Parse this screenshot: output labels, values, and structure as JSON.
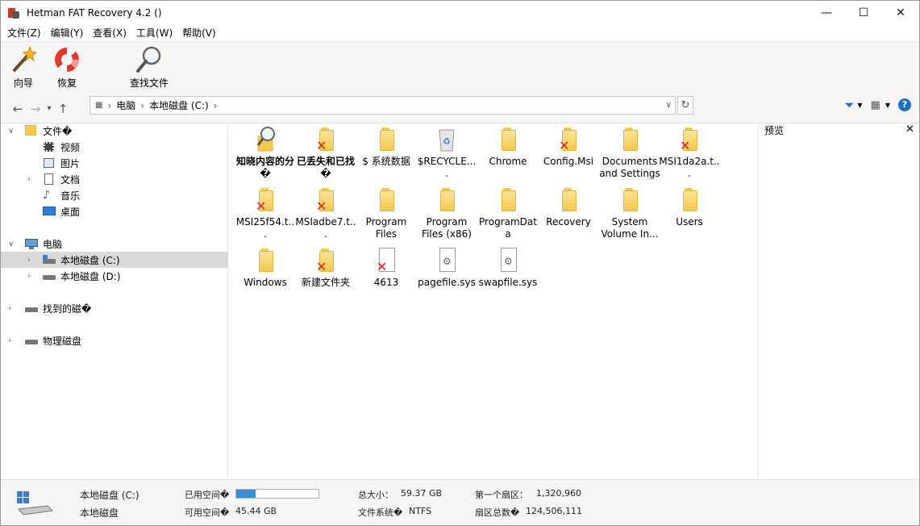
{
  "window": {
    "title": "Hetman FAT Recovery 4.2 ()",
    "minimize": "—",
    "maximize": "☐",
    "close": "✕"
  },
  "menu": [
    "文件(Z)",
    "编辑(Y)",
    "查看(X)",
    "工具(W)",
    "帮助(V)"
  ],
  "toolbar": {
    "wizard": "向导",
    "recover": "恢复",
    "find": "查找文件"
  },
  "address": {
    "root": "电脑",
    "drive": "本地磁盘 (C:)"
  },
  "tree": {
    "files": "文件�",
    "video": "视频",
    "pictures": "图片",
    "documents": "文档",
    "music": "音乐",
    "desktop": "桌面",
    "computer": "电脑",
    "drive_c": "本地磁盘 (C:)",
    "drive_d": "本地磁盘 (D:)",
    "found": "找到的磁�",
    "physical": "物理磁盘"
  },
  "files": [
    {
      "name": "知晓内容的分�",
      "type": "search",
      "bold": true
    },
    {
      "name": "已丢失和已找�",
      "type": "folder-x",
      "bold": true
    },
    {
      "name": "$ 系统数据",
      "type": "folder"
    },
    {
      "name": "$RECYCLE....",
      "type": "recycle"
    },
    {
      "name": "Chrome",
      "type": "folder"
    },
    {
      "name": "Config.Msi",
      "type": "folder-x"
    },
    {
      "name": "Documents and Settings",
      "type": "folder"
    },
    {
      "name": "MSI1da2a.t...",
      "type": "folder-x"
    },
    {
      "name": "MSI25f54.t...",
      "type": "folder-x"
    },
    {
      "name": "MSIadbe7.t...",
      "type": "folder-x"
    },
    {
      "name": "Program Files",
      "type": "folder"
    },
    {
      "name": "Program Files (x86)",
      "type": "folder"
    },
    {
      "name": "ProgramData",
      "type": "folder"
    },
    {
      "name": "Recovery",
      "type": "folder"
    },
    {
      "name": "System Volume In...",
      "type": "folder"
    },
    {
      "name": "Users",
      "type": "folder"
    },
    {
      "name": "Windows",
      "type": "folder"
    },
    {
      "name": "新建文件夹",
      "type": "folder-x"
    },
    {
      "name": "4613",
      "type": "doc-x"
    },
    {
      "name": "pagefile.sys",
      "type": "sys"
    },
    {
      "name": "swapfile.sys",
      "type": "sys"
    }
  ],
  "preview": {
    "title": "预览",
    "close": "✕"
  },
  "status": {
    "drive_name": "本地磁盘 (C:)",
    "drive_type": "本地磁盘",
    "used_label": "已用空间�",
    "used_fraction": 0.235,
    "free_label": "可用空间�",
    "free_value": "45.44 GB",
    "total_label": "总大小：",
    "total_value": "59.37 GB",
    "fs_label": "文件系统�",
    "fs_value": "NTFS",
    "first_sector_label": "第一个扇区：",
    "first_sector_value": "1,320,960",
    "sectors_label": "扇区总数�",
    "sectors_value": "124,506,111"
  },
  "colors": {
    "accent": "#3a8fd8",
    "delete_mark": "#e02020",
    "folder": "#f3c94e"
  }
}
